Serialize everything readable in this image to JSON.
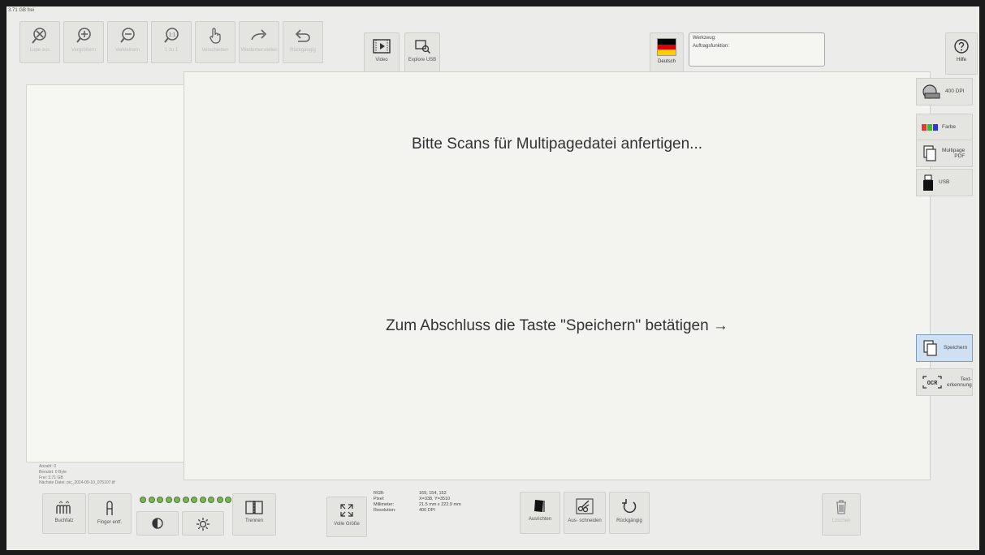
{
  "free_space": "3.71 GB frei",
  "toolbar": [
    {
      "name": "zoom-reset-button",
      "icon": "zoom-cancel-icon",
      "label": "Lupe aus",
      "disabled": true
    },
    {
      "name": "zoom-in-button",
      "icon": "zoom-in-icon",
      "label": "Vergrößern",
      "disabled": true
    },
    {
      "name": "zoom-out-button",
      "icon": "zoom-out-icon",
      "label": "Verkleinern",
      "disabled": true
    },
    {
      "name": "zoom-1to1-button",
      "icon": "zoom-1-1-icon",
      "label": "1 zu 1",
      "disabled": true
    },
    {
      "name": "pan-button",
      "icon": "hand-pointer-icon",
      "label": "Verschieben",
      "disabled": true
    },
    {
      "name": "redo-button",
      "icon": "redo-arrow-icon",
      "label": "Wiederherstellen",
      "disabled": true
    },
    {
      "name": "undo-button",
      "icon": "undo-arrow-icon",
      "label": "Rückgängig",
      "disabled": true
    }
  ],
  "video_label": "Video",
  "explore_label": "Explore USB",
  "language_label": "Deutsch",
  "info": {
    "tool_label": "Werkzeug:",
    "job_label": "Auftragsfunktion:"
  },
  "help_label": "Hilfe",
  "main": {
    "line1": "Bitte Scans für Multipagedatei anfertigen...",
    "line2": "Zum Abschluss die Taste \"Speichern\" betätigen →"
  },
  "side": {
    "dpi": "400 DPI",
    "color": "Farbe",
    "format_1": "Multipage",
    "format_2": "PDF",
    "usb": "USB",
    "save": "Speichern",
    "ocr_1": "Text-",
    "ocr_2": "erkennung"
  },
  "stats": {
    "count": "Anzahl: 0",
    "used": "Benutzt: 0 Byte",
    "free": "Frei: 3.71 GB",
    "next_file": "Nächste Datei: pic_2024-09-10_075107.tif"
  },
  "bottom": {
    "bookfold": "Buchfalz",
    "finger": "Finger entf.",
    "split": "Trennen",
    "fullsize": "Volle Größe",
    "align": "Ausrichten",
    "crop": "Aus- schneiden",
    "undo": "Rückgängig",
    "delete": "Löschen"
  },
  "pixel_info": {
    "rgb_label": "RGB:",
    "rgb_value": "169, 154, 152",
    "pixel_label": "Pixel:",
    "pixel_value": "X=338, Y=3510",
    "mm_label": "Millimeter:",
    "mm_value": "21.5 mm x 222.9 mm",
    "res_label": "Resolution:",
    "res_value": "400 DPI"
  },
  "indicator_count": 11,
  "colors": {
    "accent_selected": "#cfe0f3",
    "flag_black": "#000000",
    "flag_red": "#dd0000",
    "flag_gold": "#ffce00",
    "dot_green": "#7bb35a"
  }
}
